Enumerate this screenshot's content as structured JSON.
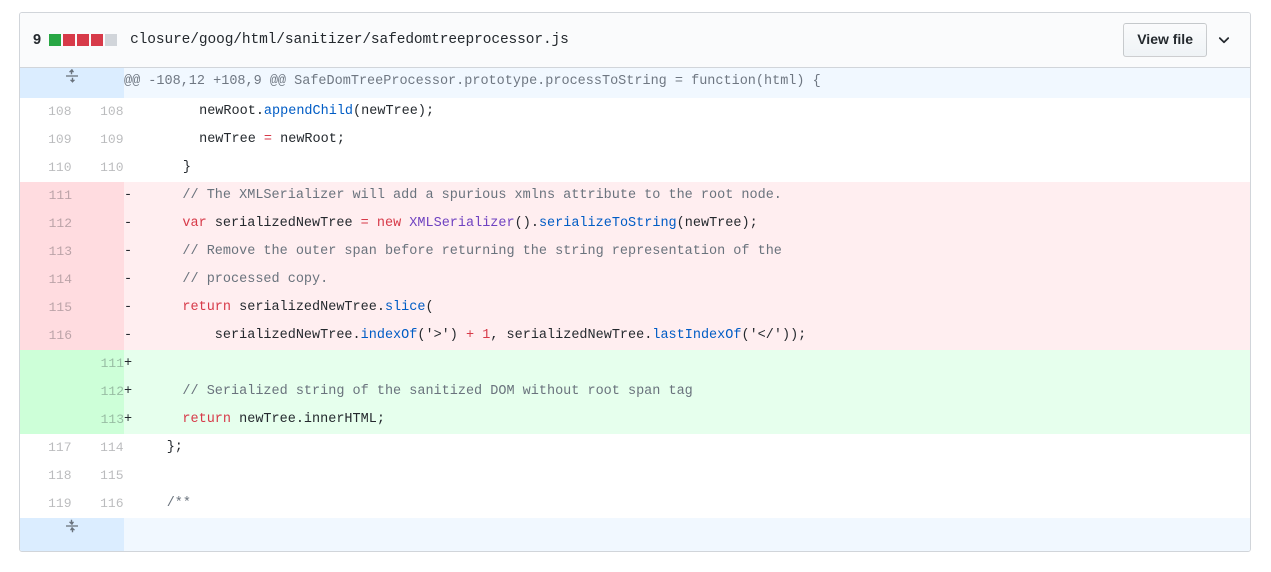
{
  "file": {
    "changes_count": "9",
    "diffstat": [
      "add",
      "del",
      "del",
      "del",
      "none"
    ],
    "path": "closure/goog/html/sanitizer/safedomtreeprocessor.js",
    "view_file_label": "View file",
    "chevron_icon": "chevron-down-icon",
    "expand_up_icon": "unfold-up-down-icon",
    "expand_down_icon": "fold-icon"
  },
  "hunk": {
    "header": "@@ -108,12 +108,9 @@ SafeDomTreeProcessor.prototype.processToString = function(html) {"
  },
  "rows": [
    {
      "type": "ctx",
      "old": "108",
      "new": "108",
      "marker": "",
      "code": "      newRoot.appendChild(newTree);"
    },
    {
      "type": "ctx",
      "old": "109",
      "new": "109",
      "marker": "",
      "code": "      newTree = newRoot;"
    },
    {
      "type": "ctx",
      "old": "110",
      "new": "110",
      "marker": "",
      "code": "    }"
    },
    {
      "type": "del",
      "old": "111",
      "new": "",
      "marker": "-",
      "code": "    // The XMLSerializer will add a spurious xmlns attribute to the root node."
    },
    {
      "type": "del",
      "old": "112",
      "new": "",
      "marker": "-",
      "code": "    var serializedNewTree = new XMLSerializer().serializeToString(newTree);"
    },
    {
      "type": "del",
      "old": "113",
      "new": "",
      "marker": "-",
      "code": "    // Remove the outer span before returning the string representation of the"
    },
    {
      "type": "del",
      "old": "114",
      "new": "",
      "marker": "-",
      "code": "    // processed copy."
    },
    {
      "type": "del",
      "old": "115",
      "new": "",
      "marker": "-",
      "code": "    return serializedNewTree.slice("
    },
    {
      "type": "del",
      "old": "116",
      "new": "",
      "marker": "-",
      "code": "        serializedNewTree.indexOf('>') + 1, serializedNewTree.lastIndexOf('</'));"
    },
    {
      "type": "add",
      "old": "",
      "new": "111",
      "marker": "+",
      "code": ""
    },
    {
      "type": "add",
      "old": "",
      "new": "112",
      "marker": "+",
      "code": "    // Serialized string of the sanitized DOM without root span tag"
    },
    {
      "type": "add",
      "old": "",
      "new": "113",
      "marker": "+",
      "code": "    return newTree.innerHTML;"
    },
    {
      "type": "ctx",
      "old": "117",
      "new": "114",
      "marker": "",
      "code": "  };"
    },
    {
      "type": "ctx",
      "old": "118",
      "new": "115",
      "marker": "",
      "code": ""
    },
    {
      "type": "ctx",
      "old": "119",
      "new": "116",
      "marker": "",
      "code": "  /**"
    }
  ],
  "colors": {
    "add_bg": "#e6ffed",
    "add_gutter": "#cdffd8",
    "del_bg": "#ffeef0",
    "del_gutter": "#ffdce0",
    "hunk_bg": "#f1f8ff",
    "expander_bg": "#dbedff",
    "border": "#d1d5da",
    "keyword": "#d73a49",
    "function": "#005cc5",
    "comment": "#6a737d",
    "entity": "#6f42c1"
  }
}
